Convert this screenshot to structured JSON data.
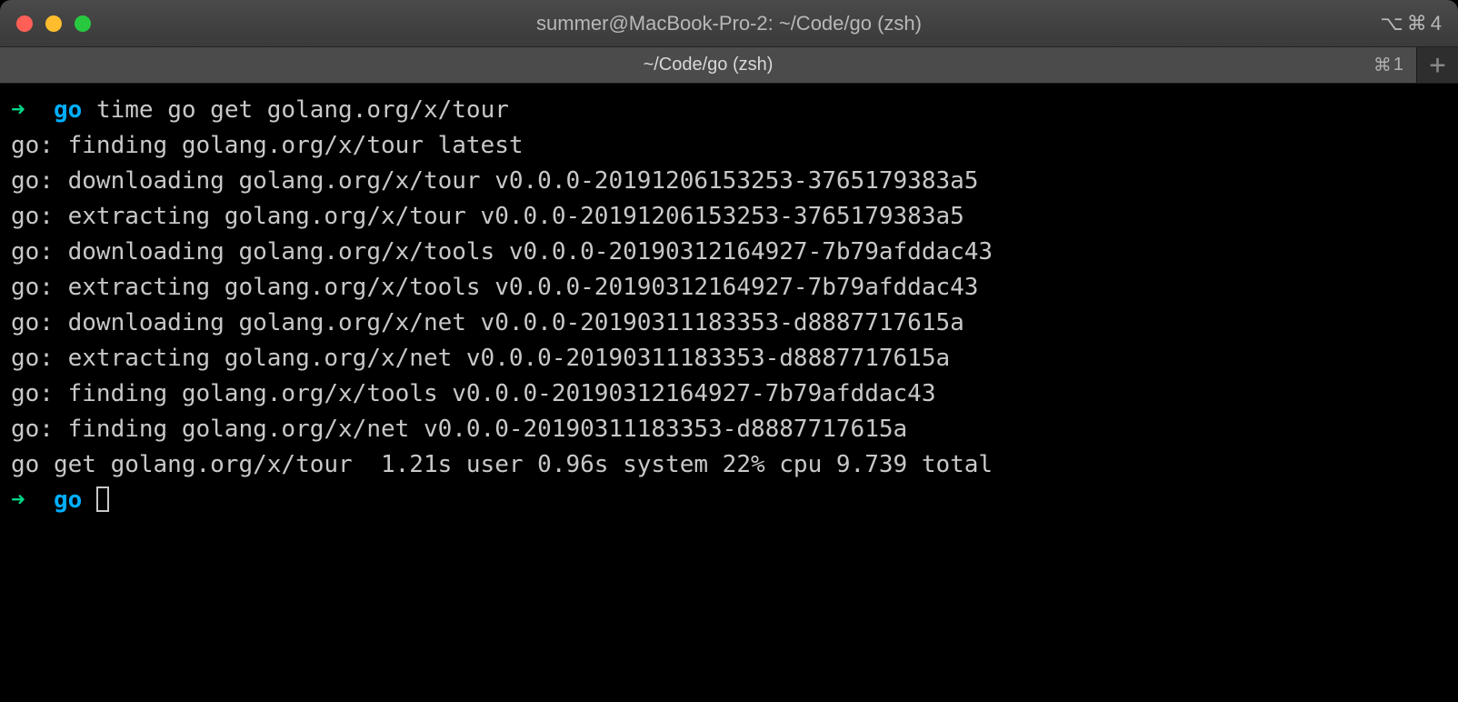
{
  "titlebar": {
    "title": "summer@MacBook-Pro-2: ~/Code/go (zsh)",
    "shortcut_alt": "⌥",
    "shortcut_cmd": "⌘",
    "shortcut_num": "4"
  },
  "tabbar": {
    "tab_label": "~/Code/go (zsh)",
    "tab_shortcut_cmd": "⌘",
    "tab_shortcut_num": "1",
    "add_label": "+"
  },
  "terminal": {
    "prompt_arrow": "➜",
    "prompt_dir": "go",
    "command": "time go get golang.org/x/tour",
    "output": [
      "go: finding golang.org/x/tour latest",
      "go: downloading golang.org/x/tour v0.0.0-20191206153253-3765179383a5",
      "go: extracting golang.org/x/tour v0.0.0-20191206153253-3765179383a5",
      "go: downloading golang.org/x/tools v0.0.0-20190312164927-7b79afddac43",
      "go: extracting golang.org/x/tools v0.0.0-20190312164927-7b79afddac43",
      "go: downloading golang.org/x/net v0.0.0-20190311183353-d8887717615a",
      "go: extracting golang.org/x/net v0.0.0-20190311183353-d8887717615a",
      "go: finding golang.org/x/tools v0.0.0-20190312164927-7b79afddac43",
      "go: finding golang.org/x/net v0.0.0-20190311183353-d8887717615a",
      "go get golang.org/x/tour  1.21s user 0.96s system 22% cpu 9.739 total"
    ]
  }
}
